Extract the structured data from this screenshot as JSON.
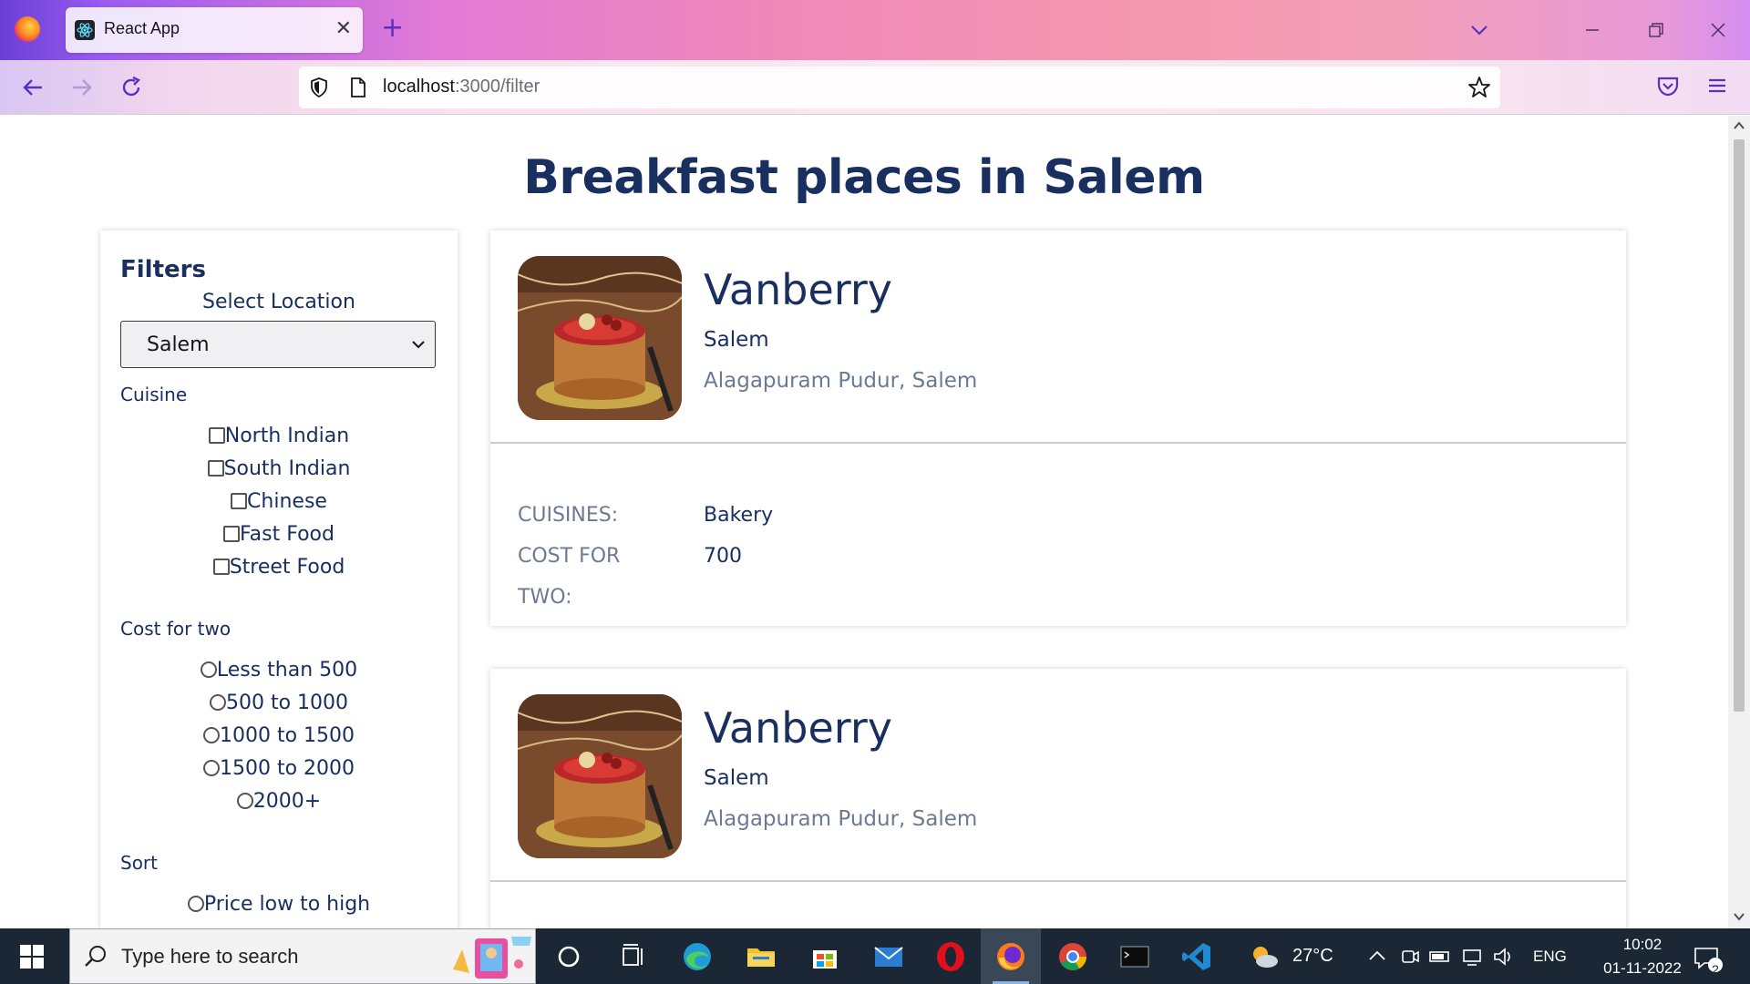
{
  "browser": {
    "tab_title": "React App",
    "new_tab_symbol": "+",
    "close_symbol": "✕",
    "url_host": "localhost",
    "url_rest": ":3000/filter"
  },
  "page": {
    "title": "Breakfast places in Salem"
  },
  "filters": {
    "heading": "Filters",
    "location_label": "Select Location",
    "location_value": "Salem",
    "cuisine_label": "Cuisine",
    "cuisines": [
      "North Indian",
      "South Indian",
      "Chinese",
      "Fast Food",
      "Street Food"
    ],
    "cost_label": "Cost for two",
    "cost_options": [
      "Less than 500",
      "500 to 1000",
      "1000 to 1500",
      "1500 to 2000",
      "2000+"
    ],
    "sort_label": "Sort",
    "sort_options": [
      "Price low to high"
    ]
  },
  "restaurants": [
    {
      "name": "Vanberry",
      "city": "Salem",
      "address": "Alagapuram Pudur, Salem",
      "cuisines_label": "CUISINES:",
      "cuisines_value": "Bakery",
      "cost_label_1": "COST FOR",
      "cost_label_2": "TWO:",
      "cost_value": "700"
    },
    {
      "name": "Vanberry",
      "city": "Salem",
      "address": "Alagapuram Pudur, Salem"
    }
  ],
  "taskbar": {
    "search_placeholder": "Type here to search",
    "weather": "27°C",
    "language": "ENG",
    "time": "10:02",
    "date": "01-11-2022",
    "notifications": "2"
  }
}
